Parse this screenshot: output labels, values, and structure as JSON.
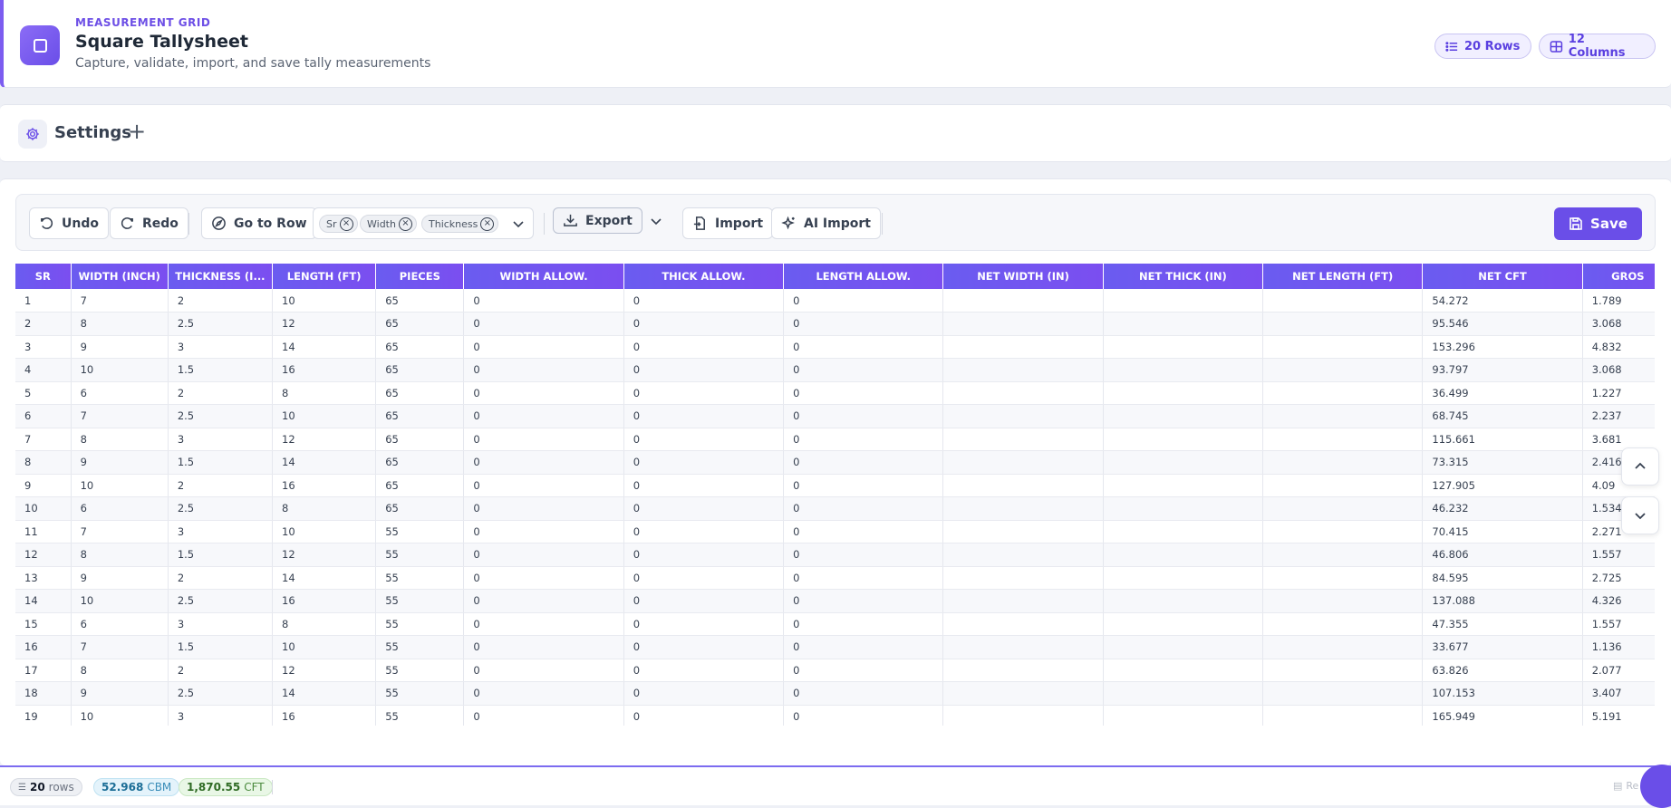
{
  "header": {
    "kicker": "MEASUREMENT GRID",
    "title": "Square Tallysheet",
    "subtitle": "Capture, validate, import, and save tally measurements",
    "rows_pill": "20 Rows",
    "cols_pill": "12 Columns"
  },
  "settings": {
    "title": "Settings",
    "toggle": "+"
  },
  "toolbar": {
    "undo": "Undo",
    "redo": "Redo",
    "goto_row": "Go to Row",
    "chips": [
      "Sr",
      "Width",
      "Thickness"
    ],
    "export": "Export",
    "import": "Import",
    "ai_import": "AI Import",
    "save": "Save"
  },
  "grid": {
    "columns": [
      "SR",
      "WIDTH (INCH)",
      "THICKNESS (I...",
      "LENGTH (FT)",
      "PIECES",
      "WIDTH ALLOW.",
      "THICK ALLOW.",
      "LENGTH ALLOW.",
      "NET WIDTH (IN)",
      "NET THICK (IN)",
      "NET LENGTH (FT)",
      "NET CFT",
      "GROS"
    ],
    "rows": [
      [
        "1",
        "7",
        "2",
        "10",
        "65",
        "0",
        "0",
        "0",
        "",
        "",
        "",
        "54.272",
        "1.789"
      ],
      [
        "2",
        "8",
        "2.5",
        "12",
        "65",
        "0",
        "0",
        "0",
        "",
        "",
        "",
        "95.546",
        "3.068"
      ],
      [
        "3",
        "9",
        "3",
        "14",
        "65",
        "0",
        "0",
        "0",
        "",
        "",
        "",
        "153.296",
        "4.832"
      ],
      [
        "4",
        "10",
        "1.5",
        "16",
        "65",
        "0",
        "0",
        "0",
        "",
        "",
        "",
        "93.797",
        "3.068"
      ],
      [
        "5",
        "6",
        "2",
        "8",
        "65",
        "0",
        "0",
        "0",
        "",
        "",
        "",
        "36.499",
        "1.227"
      ],
      [
        "6",
        "7",
        "2.5",
        "10",
        "65",
        "0",
        "0",
        "0",
        "",
        "",
        "",
        "68.745",
        "2.237"
      ],
      [
        "7",
        "8",
        "3",
        "12",
        "65",
        "0",
        "0",
        "0",
        "",
        "",
        "",
        "115.661",
        "3.681"
      ],
      [
        "8",
        "9",
        "1.5",
        "14",
        "65",
        "0",
        "0",
        "0",
        "",
        "",
        "",
        "73.315",
        "2.416"
      ],
      [
        "9",
        "10",
        "2",
        "16",
        "65",
        "0",
        "0",
        "0",
        "",
        "",
        "",
        "127.905",
        "4.09"
      ],
      [
        "10",
        "6",
        "2.5",
        "8",
        "65",
        "0",
        "0",
        "0",
        "",
        "",
        "",
        "46.232",
        "1.534"
      ],
      [
        "11",
        "7",
        "3",
        "10",
        "55",
        "0",
        "0",
        "0",
        "",
        "",
        "",
        "70.415",
        "2.271"
      ],
      [
        "12",
        "8",
        "1.5",
        "12",
        "55",
        "0",
        "0",
        "0",
        "",
        "",
        "",
        "46.806",
        "1.557"
      ],
      [
        "13",
        "9",
        "2",
        "14",
        "55",
        "0",
        "0",
        "0",
        "",
        "",
        "",
        "84.595",
        "2.725"
      ],
      [
        "14",
        "10",
        "2.5",
        "16",
        "55",
        "0",
        "0",
        "0",
        "",
        "",
        "",
        "137.088",
        "4.326"
      ],
      [
        "15",
        "6",
        "3",
        "8",
        "55",
        "0",
        "0",
        "0",
        "",
        "",
        "",
        "47.355",
        "1.557"
      ],
      [
        "16",
        "7",
        "1.5",
        "10",
        "55",
        "0",
        "0",
        "0",
        "",
        "",
        "",
        "33.677",
        "1.136"
      ],
      [
        "17",
        "8",
        "2",
        "12",
        "55",
        "0",
        "0",
        "0",
        "",
        "",
        "",
        "63.826",
        "2.077"
      ],
      [
        "18",
        "9",
        "2.5",
        "14",
        "55",
        "0",
        "0",
        "0",
        "",
        "",
        "",
        "107.153",
        "3.407"
      ],
      [
        "19",
        "10",
        "3",
        "16",
        "55",
        "0",
        "0",
        "0",
        "",
        "",
        "",
        "165.949",
        "5.191"
      ]
    ]
  },
  "footer": {
    "rows_count": "20",
    "rows_label": "rows",
    "cbm_value": "52.968",
    "cbm_label": "CBM",
    "cft_value": "1,870.55",
    "cft_label": "CFT",
    "right_text": "Re"
  },
  "colors": {
    "accent": "#6a4ee8",
    "header_gradient_start": "#6a5cf0",
    "header_gradient_end": "#7b4ef0"
  }
}
